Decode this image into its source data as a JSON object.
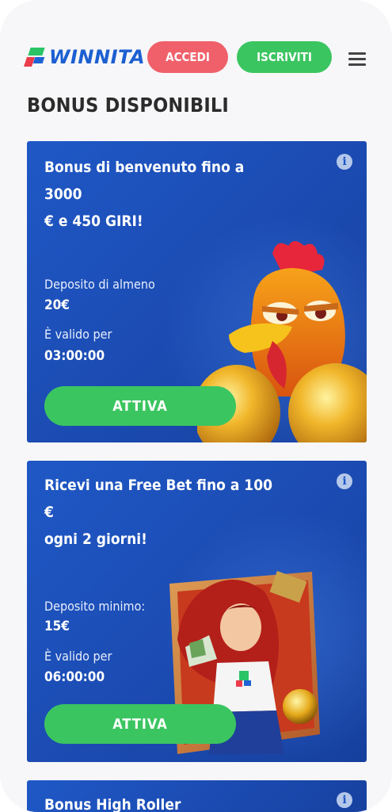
{
  "header": {
    "logo_text": "WINNITA",
    "login_label": "ACCEDI",
    "signup_label": "ISCRIVITI"
  },
  "page_title": "BONUS DISPONIBILI",
  "cards": [
    {
      "title_line1": "Bonus di benvenuto fino a 3000",
      "title_line2": "€ e 450 GIRI!",
      "deposit_label": "Deposito di almeno",
      "deposit_value": "20€",
      "valid_label": "È valido per",
      "valid_value": "03:00:00",
      "button_label": "ATTIVA"
    },
    {
      "title_line1": "Ricevi una Free Bet fino a 100 €",
      "title_line2": "ogni 2 giorni!",
      "deposit_label": "Deposito minimo:",
      "deposit_value": "15€",
      "valid_label": "È valido per",
      "valid_value": "06:00:00",
      "button_label": "ATTIVA"
    },
    {
      "title_line1": "Bonus High Roller"
    }
  ],
  "icons": {
    "info": "info-icon",
    "menu": "hamburger-menu-icon"
  },
  "colors": {
    "brand_blue": "#1c5fd1",
    "login_red": "#f0606a",
    "signup_green": "#3bc560",
    "card_blue": "#1f58c6"
  }
}
